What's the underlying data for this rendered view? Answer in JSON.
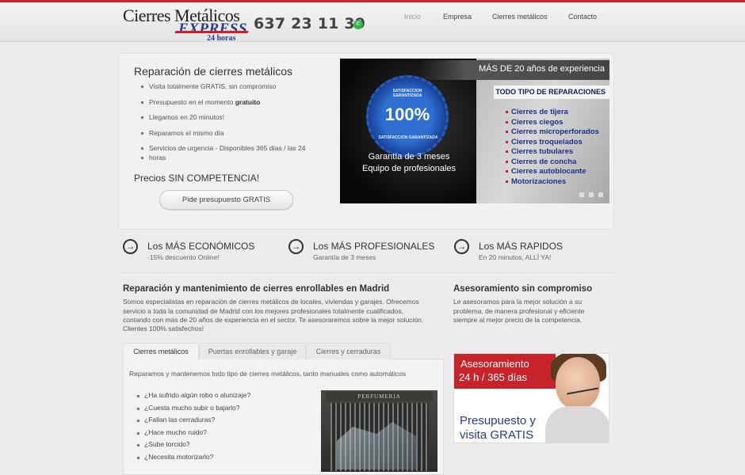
{
  "header": {
    "logo_line1": "Cierres Metálicos",
    "logo_line2": "EXPRESS",
    "logo_line3": "24 horas",
    "phone": "637 23 11 39",
    "whatsapp_icon": "whatsapp-icon",
    "nav": [
      "Inicio",
      "Empresa",
      "Cierres metálicos",
      "Contacto"
    ]
  },
  "hero": {
    "title": "Reparación de cierres metálicos",
    "bullets": [
      "Visita totalmente GRATIS, sin compromiso",
      "Presupuesto en el momento ",
      "gratuito",
      "Llegamos en 20 minutos!",
      "Reparamos el mismo día",
      "Servicios de urgencia - Disponibles 365 días / las 24",
      "horas"
    ],
    "price_title": "Precios SIN COMPETENCIA!",
    "button": "Pide presupuesto GRATIS"
  },
  "slider": {
    "top_text": "MÁS DE 20 años de experiencia",
    "badge_pct": "100%",
    "badge_ring_top": "SATISFACCION GARANTIZADA",
    "badge_ring_bottom": "SATISFACCION GARANTIZADA",
    "guarantee_1": "Garantía de 3 meses",
    "guarantee_2": "Equipo de profesionales",
    "types_title": "TODO TIPO DE REPARACIONES",
    "types": [
      "Cierres de tijera",
      "Cierres ciegos",
      "Cierres microperforados",
      "Cierres troquelados",
      "Cierres tubulares",
      "Cierres de concha",
      "Cierres autoblocante",
      "Motorizaciones"
    ],
    "dots_count": 3
  },
  "features": [
    {
      "title": "Los MÁS ECONÓMICOS",
      "sub": "-15% descuento Online!",
      "icon": "arrow-right-icon"
    },
    {
      "title": "Los MÁS PROFESIONALES",
      "sub": "Garantía de 3 meses",
      "icon": "arrow-right-icon"
    },
    {
      "title": "Los MÁS RAPIDOS",
      "sub": "En 20 minutos, ALLÍ YA!",
      "icon": "arrow-right-icon"
    }
  ],
  "content": {
    "title": "Reparación y mantenimiento de cierres enrollables en Madrid",
    "lines": [
      "Somos especialistas en reparación de cierres metálicos de locales, viviendas y garajes. Ofrecemos",
      "servicio a toda la comunidad de Madrid con los mejores profesionales totalmente cualificados,",
      "contando con más de 20 años de experiencia en el sector. Te asesoraremos sobre la mejor solución.",
      "Clientes 100% satisfechos!"
    ],
    "tabs": [
      "Cierres metálicos",
      "Puertas enrollables y garaje",
      "Cierres y cerraduras"
    ],
    "tab_intro": "Reparamos y mantenemos todo tipo de cierres metálicos, tanto manuales como automáticos",
    "questions": [
      "¿Ha sufrido algún robo o alunizaje?",
      "¿Cuesta mucho subir o bajarlo?",
      "¿Fallan las cerraduras?",
      "¿Hace mucho ruido?",
      "¿Sube torcido?",
      "¿Necesita motorizarlo?"
    ],
    "photo_sign": "PERFUMERIA"
  },
  "sidebar": {
    "title": "Asesoramiento sin compromiso",
    "lines": [
      "Le asesoramos para la mejor solución a su",
      "problema, de manera profesional y eficiente",
      "siempre al mejor precio de la competencia."
    ],
    "promo_red_1": "Asesoramiento",
    "promo_red_2": "24 h / 365 días",
    "promo_blue_1": "Presupuesto y",
    "promo_blue_2": "visita GRATIS"
  },
  "colors": {
    "accent_red": "#c8232b",
    "brand_blue": "#2a3b8f"
  }
}
